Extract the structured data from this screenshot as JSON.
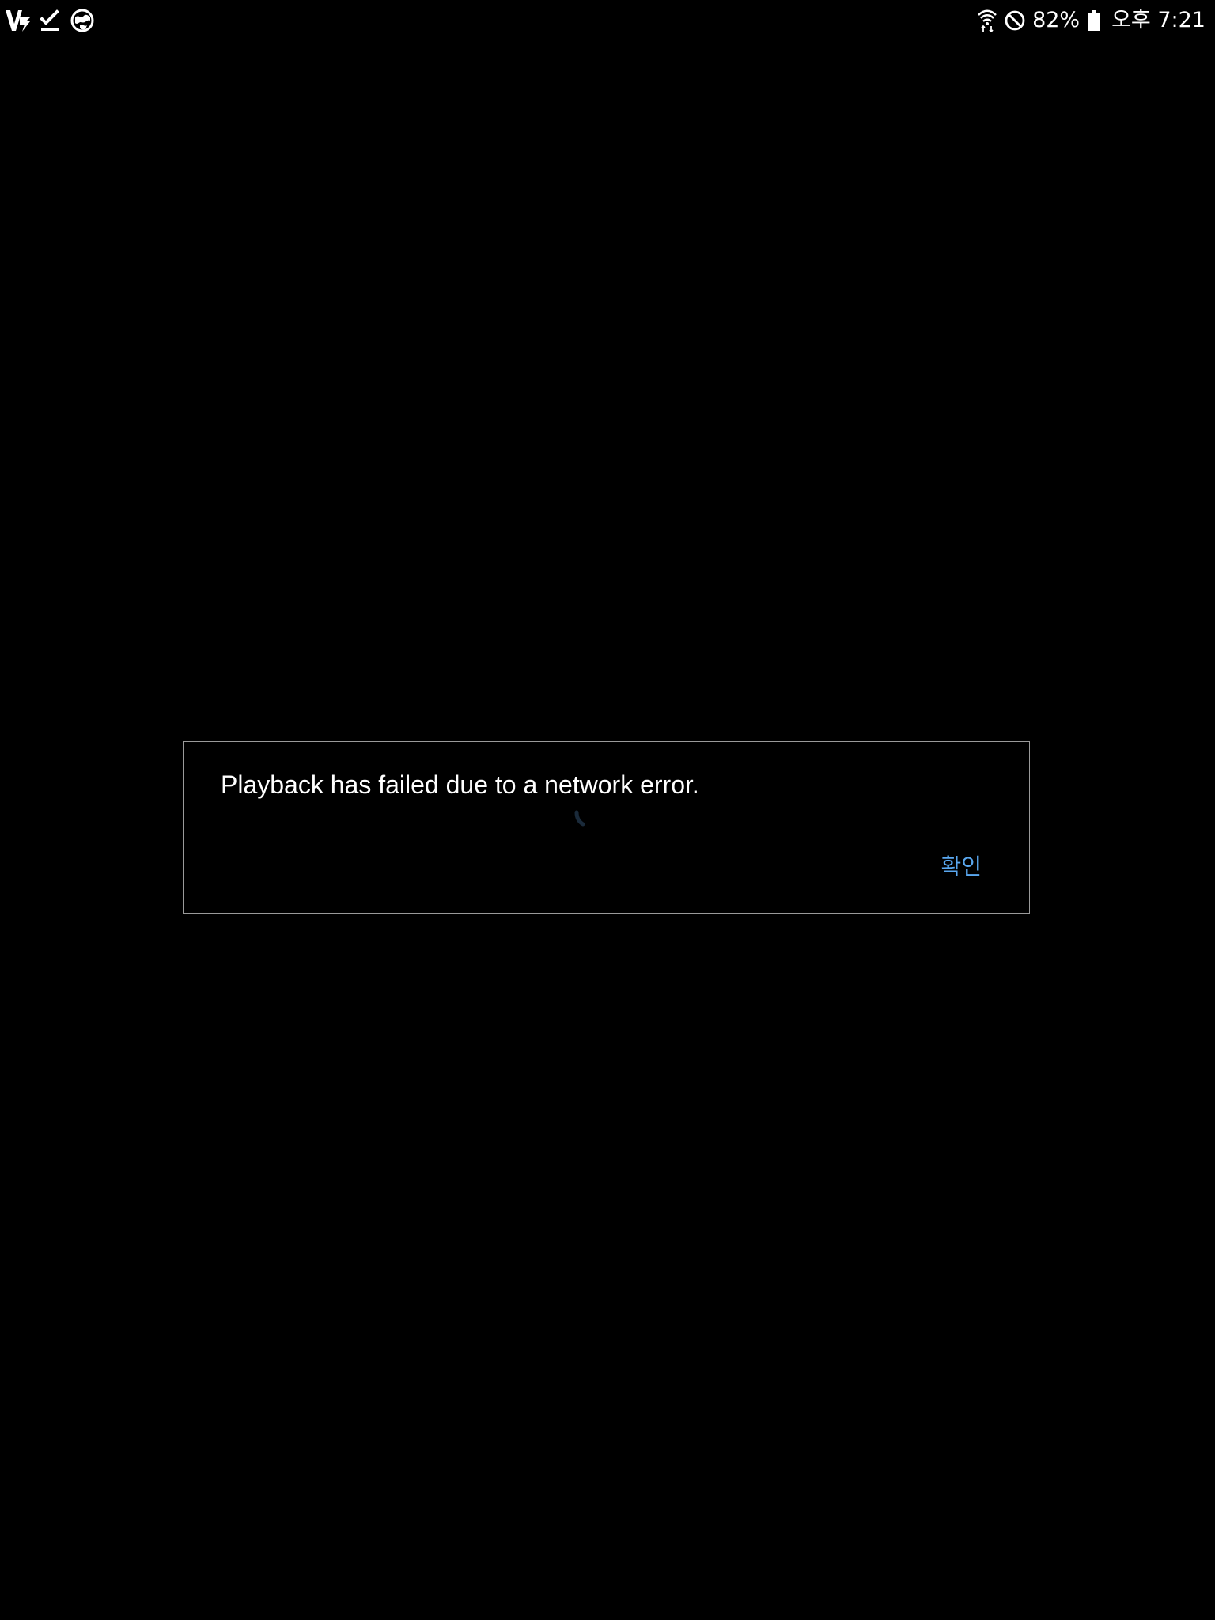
{
  "status_bar": {
    "left_icons": [
      "v3-app-icon",
      "task-done-icon",
      "network-globe-icon"
    ],
    "right_icons": [
      "wifi-icon",
      "do-not-disturb-icon",
      "battery-icon"
    ],
    "battery_percent": "82%",
    "battery_level": 0.82,
    "time": "오후 7:21"
  },
  "dialog": {
    "message": "Playback has failed due to a network error.",
    "confirm_label": "확인",
    "accent_color": "#5aa8f0",
    "border_color": "#9a9a9a",
    "background_color": "#000000"
  },
  "loading_spinner": {
    "icon": "loading-spinner-icon",
    "state": "loading"
  }
}
